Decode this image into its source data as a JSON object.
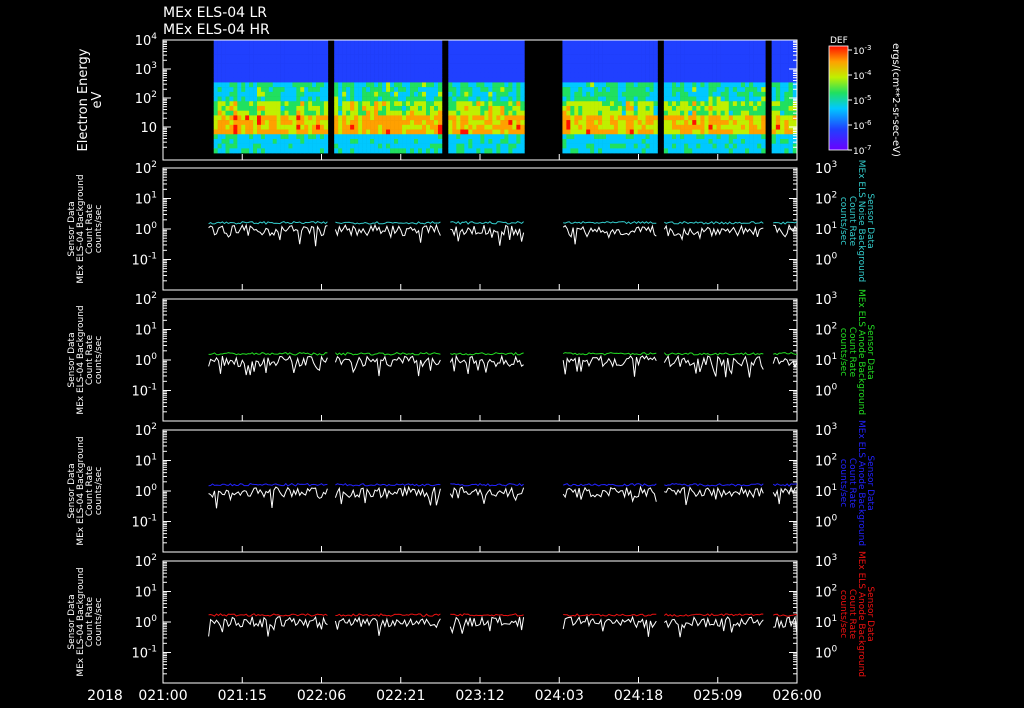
{
  "header": {
    "title_lines": [
      "MEx ELS-04 LR",
      "MEx ELS-04 HR"
    ]
  },
  "colors": {
    "background": "#000000",
    "axes": "#ffffff",
    "white_series": "#ffffff",
    "cyan": "#33cccc",
    "green": "#22dd22",
    "blue": "#2222ff",
    "red": "#ee1111"
  },
  "chart_data": [
    {
      "type": "heatmap",
      "ylabel_lines": [
        "Electron Energy",
        "eV"
      ],
      "yscale": "log",
      "y_ticks": [
        {
          "mant": "10",
          "exp": ""
        },
        {
          "mant": "10",
          "exp": "2"
        },
        {
          "mant": "10",
          "exp": "3"
        },
        {
          "mant": "10",
          "exp": "4"
        }
      ],
      "colorbar": {
        "label": "DEF",
        "title_vertical": "ergs/(cm**2-sr-sec-eV)",
        "ticks": [
          {
            "mant": "10",
            "exp": "-3"
          },
          {
            "mant": "10",
            "exp": "-4"
          },
          {
            "mant": "10",
            "exp": "-5"
          },
          {
            "mant": "10",
            "exp": "-6"
          },
          {
            "mant": "10",
            "exp": "-7"
          }
        ],
        "range": [
          1e-07,
          0.001
        ]
      },
      "data_segments": [
        [
          0.08,
          0.26
        ],
        [
          0.27,
          0.44
        ],
        [
          0.45,
          0.57
        ],
        [
          0.63,
          0.78
        ],
        [
          0.79,
          0.95
        ],
        [
          0.96,
          1.0
        ]
      ],
      "gap_fill": "#000000"
    },
    {
      "type": "line",
      "ylabel_lines": [
        "Sensor Data",
        "MEx ELS-04 Background",
        "Count Rate",
        "counts/sec"
      ],
      "right_label_lines": [
        "Sensor Data",
        "MEx ELS Noise Background",
        "Count Rate",
        "counts/sec"
      ],
      "yscale": "log",
      "left_ticks": [
        {
          "mant": "10",
          "exp": "-1"
        },
        {
          "mant": "10",
          "exp": "0"
        },
        {
          "mant": "10",
          "exp": "1"
        },
        {
          "mant": "10",
          "exp": "2"
        }
      ],
      "right_ticks": [
        {
          "mant": "10",
          "exp": "0"
        },
        {
          "mant": "10",
          "exp": "1"
        },
        {
          "mant": "10",
          "exp": "2"
        },
        {
          "mant": "10",
          "exp": "3"
        }
      ],
      "ylim_left": [
        0.01,
        100
      ],
      "series": [
        {
          "color_key": "white_series",
          "level": 0.9
        },
        {
          "color_key": "cyan",
          "level": 1.6
        }
      ]
    },
    {
      "type": "line",
      "ylabel_lines": [
        "Sensor Data",
        "MEx ELS-04 Background",
        "Count Rate",
        "counts/sec"
      ],
      "right_label_lines": [
        "Sensor Data",
        "MEx ELS Anode Background",
        "Count Rate",
        "counts/sec"
      ],
      "yscale": "log",
      "left_ticks": [
        {
          "mant": "10",
          "exp": "-1"
        },
        {
          "mant": "10",
          "exp": "0"
        },
        {
          "mant": "10",
          "exp": "1"
        },
        {
          "mant": "10",
          "exp": "2"
        }
      ],
      "right_ticks": [
        {
          "mant": "10",
          "exp": "0"
        },
        {
          "mant": "10",
          "exp": "1"
        },
        {
          "mant": "10",
          "exp": "2"
        },
        {
          "mant": "10",
          "exp": "3"
        }
      ],
      "ylim_left": [
        0.01,
        100
      ],
      "series": [
        {
          "color_key": "white_series",
          "level": 0.9
        },
        {
          "color_key": "green",
          "level": 1.6
        }
      ]
    },
    {
      "type": "line",
      "ylabel_lines": [
        "Sensor Data",
        "MEx ELS-04 Background",
        "Count Rate",
        "counts/sec"
      ],
      "right_label_lines": [
        "Sensor Data",
        "MEx ELS Anode Background",
        "Count Rate",
        "counts/sec"
      ],
      "yscale": "log",
      "left_ticks": [
        {
          "mant": "10",
          "exp": "-1"
        },
        {
          "mant": "10",
          "exp": "0"
        },
        {
          "mant": "10",
          "exp": "1"
        },
        {
          "mant": "10",
          "exp": "2"
        }
      ],
      "right_ticks": [
        {
          "mant": "10",
          "exp": "0"
        },
        {
          "mant": "10",
          "exp": "1"
        },
        {
          "mant": "10",
          "exp": "2"
        },
        {
          "mant": "10",
          "exp": "3"
        }
      ],
      "ylim_left": [
        0.01,
        100
      ],
      "series": [
        {
          "color_key": "white_series",
          "level": 0.9
        },
        {
          "color_key": "blue",
          "level": 1.6
        }
      ]
    },
    {
      "type": "line",
      "ylabel_lines": [
        "Sensor Data",
        "MEx ELS-04 Background",
        "Count Rate",
        "counts/sec"
      ],
      "right_label_lines": [
        "Sensor Data",
        "MEx ELS Anode Background",
        "Count Rate",
        "counts/sec"
      ],
      "yscale": "log",
      "left_ticks": [
        {
          "mant": "10",
          "exp": "-1"
        },
        {
          "mant": "10",
          "exp": "0"
        },
        {
          "mant": "10",
          "exp": "1"
        },
        {
          "mant": "10",
          "exp": "2"
        }
      ],
      "right_ticks": [
        {
          "mant": "10",
          "exp": "0"
        },
        {
          "mant": "10",
          "exp": "1"
        },
        {
          "mant": "10",
          "exp": "2"
        },
        {
          "mant": "10",
          "exp": "3"
        }
      ],
      "ylim_left": [
        0.01,
        100
      ],
      "series": [
        {
          "color_key": "white_series",
          "level": 1.0
        },
        {
          "color_key": "red",
          "level": 1.7
        }
      ]
    }
  ],
  "x_axis": {
    "year_label": "2018",
    "tick_labels": [
      "021:00",
      "021:15",
      "022:06",
      "022:21",
      "023:12",
      "024:03",
      "024:18",
      "025:09",
      "026:00"
    ]
  },
  "data_gaps": [
    [
      0.26,
      0.27
    ],
    [
      0.44,
      0.45
    ],
    [
      0.57,
      0.63
    ],
    [
      0.78,
      0.79
    ],
    [
      0.95,
      0.96
    ]
  ]
}
